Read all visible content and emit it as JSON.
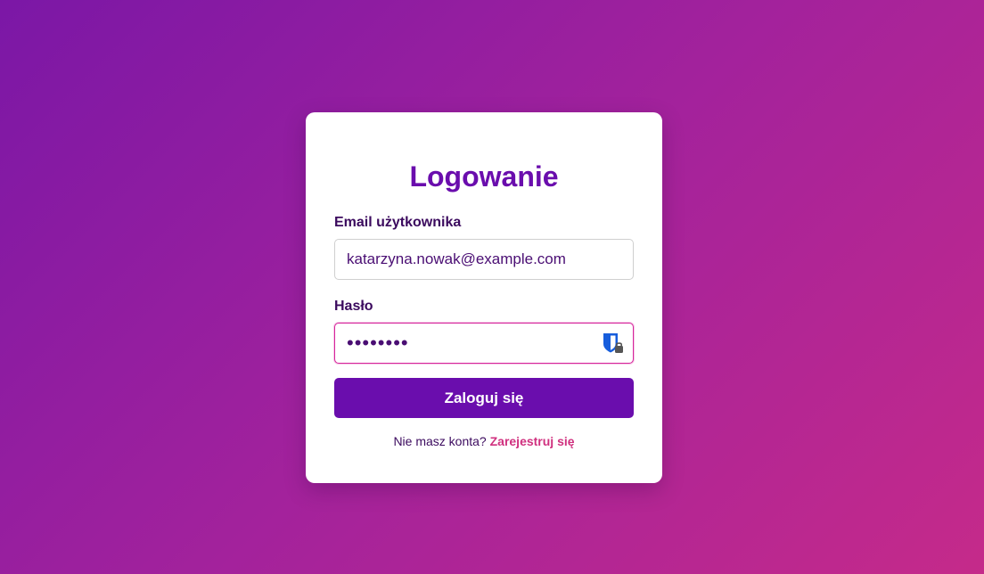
{
  "login": {
    "title": "Logowanie",
    "email_label": "Email użytkownika",
    "email_value": "katarzyna.nowak@example.com",
    "password_label": "Hasło",
    "password_value": "dummypwd",
    "submit_label": "Zaloguj się",
    "signup_prompt": "Nie masz konta?",
    "signup_link": "Zarejestruj się"
  },
  "colors": {
    "accent": "#6a0dad",
    "link": "#d0317f",
    "gradient_start": "#7b17a6",
    "gradient_end": "#c52a8a"
  },
  "icons": {
    "password_field": "password-manager-icon"
  }
}
